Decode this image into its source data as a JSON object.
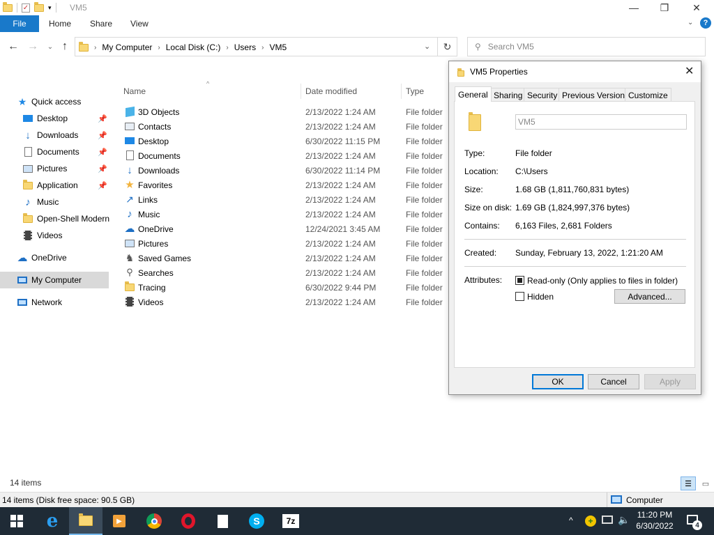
{
  "window": {
    "title": "VM5",
    "ribbon_tabs": [
      "File",
      "Home",
      "Share",
      "View"
    ]
  },
  "address": {
    "crumbs": [
      "My Computer",
      "Local Disk (C:)",
      "Users",
      "VM5"
    ],
    "search_placeholder": "Search VM5"
  },
  "nav": {
    "quick_access": "Quick access",
    "items": [
      {
        "label": "Desktop",
        "icon": "desktop-icon",
        "pinned": true
      },
      {
        "label": "Downloads",
        "icon": "downloads-icon",
        "pinned": true
      },
      {
        "label": "Documents",
        "icon": "documents-icon",
        "pinned": true
      },
      {
        "label": "Pictures",
        "icon": "pictures-icon",
        "pinned": true
      },
      {
        "label": "Application",
        "icon": "folder-icon",
        "pinned": true
      },
      {
        "label": "Music",
        "icon": "music-icon",
        "pinned": false
      },
      {
        "label": "Open-Shell Modern",
        "icon": "folder-icon",
        "pinned": false
      },
      {
        "label": "Videos",
        "icon": "videos-icon",
        "pinned": false
      }
    ],
    "onedrive": "OneDrive",
    "my_computer": "My Computer",
    "network": "Network"
  },
  "filelist": {
    "columns": {
      "name": "Name",
      "date": "Date modified",
      "type": "Type"
    },
    "rows": [
      {
        "name": "3D Objects",
        "date": "2/13/2022 1:24 AM",
        "type": "File folder",
        "icon": "3d-objects-icon"
      },
      {
        "name": "Contacts",
        "date": "2/13/2022 1:24 AM",
        "type": "File folder",
        "icon": "contacts-icon"
      },
      {
        "name": "Desktop",
        "date": "6/30/2022 11:15 PM",
        "type": "File folder",
        "icon": "desktop-icon"
      },
      {
        "name": "Documents",
        "date": "2/13/2022 1:24 AM",
        "type": "File folder",
        "icon": "documents-icon"
      },
      {
        "name": "Downloads",
        "date": "6/30/2022 11:14 PM",
        "type": "File folder",
        "icon": "downloads-icon"
      },
      {
        "name": "Favorites",
        "date": "2/13/2022 1:24 AM",
        "type": "File folder",
        "icon": "favorites-icon"
      },
      {
        "name": "Links",
        "date": "2/13/2022 1:24 AM",
        "type": "File folder",
        "icon": "links-icon"
      },
      {
        "name": "Music",
        "date": "2/13/2022 1:24 AM",
        "type": "File folder",
        "icon": "music-icon"
      },
      {
        "name": "OneDrive",
        "date": "12/24/2021 3:45 AM",
        "type": "File folder",
        "icon": "onedrive-icon"
      },
      {
        "name": "Pictures",
        "date": "2/13/2022 1:24 AM",
        "type": "File folder",
        "icon": "pictures-icon"
      },
      {
        "name": "Saved Games",
        "date": "2/13/2022 1:24 AM",
        "type": "File folder",
        "icon": "saved-games-icon"
      },
      {
        "name": "Searches",
        "date": "2/13/2022 1:24 AM",
        "type": "File folder",
        "icon": "searches-icon"
      },
      {
        "name": "Tracing",
        "date": "6/30/2022 9:44 PM",
        "type": "File folder",
        "icon": "folder-icon"
      },
      {
        "name": "Videos",
        "date": "2/13/2022 1:24 AM",
        "type": "File folder",
        "icon": "videos-icon"
      }
    ]
  },
  "status": {
    "item_count": "14 items",
    "bar_text": "14 items (Disk free space: 90.5 GB)",
    "location": "Computer"
  },
  "dialog": {
    "title": "VM5 Properties",
    "tabs": [
      "General",
      "Sharing",
      "Security",
      "Previous Versions",
      "Customize"
    ],
    "name_value": "VM5",
    "props": {
      "type_label": "Type:",
      "type_value": "File folder",
      "location_label": "Location:",
      "location_value": "C:\\Users",
      "size_label": "Size:",
      "size_value": "1.68 GB (1,811,760,831 bytes)",
      "size_on_disk_label": "Size on disk:",
      "size_on_disk_value": "1.69 GB (1,824,997,376 bytes)",
      "contains_label": "Contains:",
      "contains_value": "6,163 Files, 2,681 Folders",
      "created_label": "Created:",
      "created_value": "Sunday, February 13, 2022, 1:21:20 AM",
      "attributes_label": "Attributes:",
      "readonly_label": "Read-only (Only applies to files in folder)",
      "hidden_label": "Hidden",
      "advanced_label": "Advanced..."
    },
    "buttons": {
      "ok": "OK",
      "cancel": "Cancel",
      "apply": "Apply"
    }
  },
  "taskbar": {
    "time": "11:20 PM",
    "date": "6/30/2022",
    "notification_count": "4",
    "zip_label": "7z"
  },
  "colors": {
    "accent": "#1979ca",
    "taskbar": "#1f2b36",
    "folder": "#f8d775"
  }
}
